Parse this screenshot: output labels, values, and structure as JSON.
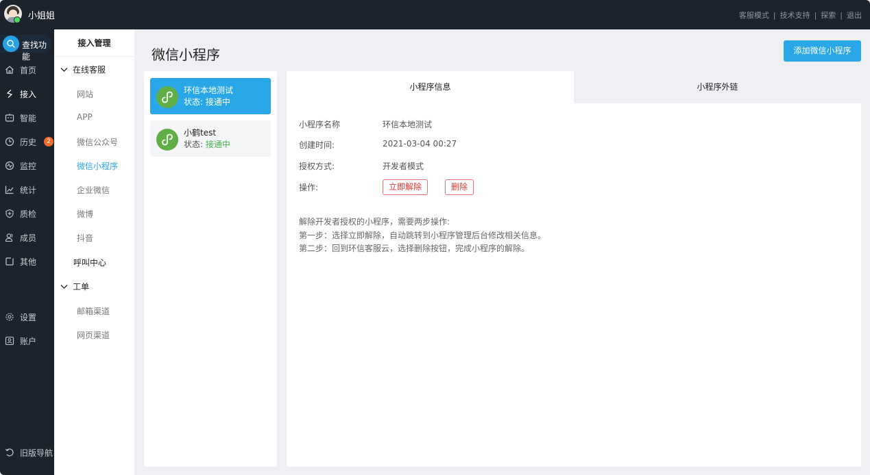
{
  "user": {
    "name": "小姐姐"
  },
  "top_links": [
    "客服模式",
    "技术支持",
    "探索",
    "退出"
  ],
  "left_nav": {
    "search_label": "查找功能",
    "items": [
      {
        "label": "首页",
        "icon": "home-icon"
      },
      {
        "label": "接入",
        "icon": "access-icon"
      },
      {
        "label": "智能",
        "icon": "robot-icon"
      },
      {
        "label": "历史",
        "icon": "clock-icon",
        "badge": "2"
      },
      {
        "label": "监控",
        "icon": "monitor-icon"
      },
      {
        "label": "统计",
        "icon": "stats-icon"
      },
      {
        "label": "质检",
        "icon": "quality-icon"
      },
      {
        "label": "成员",
        "icon": "members-icon"
      },
      {
        "label": "其他",
        "icon": "other-icon"
      },
      {
        "label": "设置",
        "icon": "gear-icon"
      },
      {
        "label": "账户",
        "icon": "account-icon"
      }
    ],
    "old_nav_label": "旧版导航"
  },
  "sub_nav": {
    "title": "接入管理",
    "group1": "在线客服",
    "group1_items": [
      "网站",
      "APP",
      "微信公众号",
      "微信小程序",
      "企业微信",
      "微博",
      "抖音"
    ],
    "group2": "呼叫中心",
    "group3": "工单",
    "group3_items": [
      "邮箱渠道",
      "网页渠道"
    ]
  },
  "main": {
    "title": "微信小程序",
    "add_button": "添加微信小程序"
  },
  "mini_programs": [
    {
      "name": "环信本地测试",
      "status_label": "状态:",
      "status_value": "接通中"
    },
    {
      "name": "小鹤test",
      "status_label": "状态:",
      "status_value": "接通中"
    }
  ],
  "tabs": [
    "小程序信息",
    "小程序外链"
  ],
  "info": {
    "name_label": "小程序名称",
    "name_value": "环信本地测试",
    "created_label": "创建时间:",
    "created_value": "2021-03-04 00:27",
    "auth_label": "授权方式:",
    "auth_value": "开发者模式",
    "ops_label": "操作:",
    "release_button": "立即解除",
    "delete_button": "删除"
  },
  "notes": [
    "解除开发者授权的小程序，需要两步操作:",
    "第一步：选择立即解除，自动跳转到小程序管理后台修改相关信息。",
    "第二步：回到环信客服云，选择删除按钮，完成小程序的解除。"
  ],
  "colors": {
    "accent": "#29a7e6",
    "dark": "#1c232c",
    "danger": "#e53935",
    "success": "#4caf50"
  }
}
